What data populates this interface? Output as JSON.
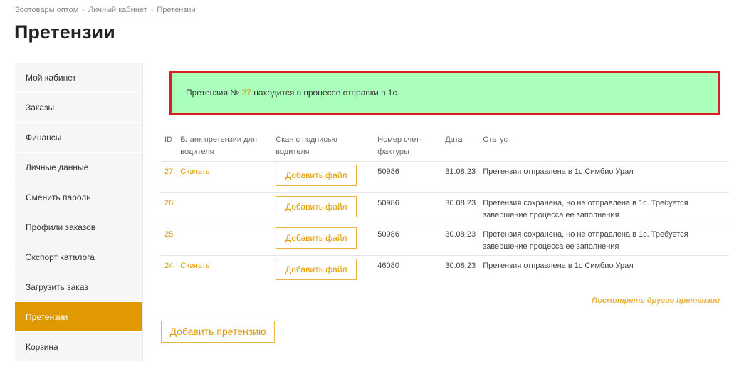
{
  "breadcrumb": {
    "items": [
      "Зоотовары оптом",
      "Личный кабинет",
      "Претензии"
    ],
    "separator": "-"
  },
  "page_title": "Претензии",
  "sidebar": {
    "items": [
      {
        "label": "Мой кабинет"
      },
      {
        "label": "Заказы"
      },
      {
        "label": "Финансы"
      },
      {
        "label": "Личные данные"
      },
      {
        "label": "Сменить пароль"
      },
      {
        "label": "Профили заказов"
      },
      {
        "label": "Экспорт каталога"
      },
      {
        "label": "Загрузить заказ"
      },
      {
        "label": "Претензии",
        "active": true
      },
      {
        "label": "Корзина"
      }
    ]
  },
  "alert": {
    "prefix": "Претензия №",
    "claim_number": "27",
    "suffix": "находится в процессе отправки в 1с."
  },
  "table": {
    "headers": {
      "id": "ID",
      "blank": "Бланк претензии для водителя",
      "scan": "Скан с подписью водителя",
      "invoice": "Номер счет-фактуры",
      "date": "Дата",
      "status": "Статус"
    },
    "rows": [
      {
        "id": "27",
        "blank": "Скачать",
        "scan": "Добавить файл",
        "invoice": "50986",
        "date": "31.08.23",
        "status": "Претензия отправлена в 1с Симбио Урал"
      },
      {
        "id": "26",
        "blank": "",
        "scan": "Добавить файл",
        "invoice": "50986",
        "date": "30.08.23",
        "status": "Претензия сохранена, но не отправлена в 1с. Требуется завершение процесса ее заполнения"
      },
      {
        "id": "25",
        "blank": "",
        "scan": "Добавить файл",
        "invoice": "50986",
        "date": "30.08.23",
        "status": "Претензия сохранена, но не отправлена в 1с. Требуется завершение процесса ее заполнения"
      },
      {
        "id": "24",
        "blank": "Скачать",
        "scan": "Добавить файл",
        "invoice": "46080",
        "date": "30.08.23",
        "status": "Претензия отправлена в 1с Симбио Урал"
      }
    ]
  },
  "other_claims_link": "Посмотреть другие претензии",
  "add_claim_button": "Добавить претензию",
  "colors": {
    "accent": "#e09a00",
    "alert_bg": "#aaffbb",
    "alert_border": "#dd1c24"
  }
}
